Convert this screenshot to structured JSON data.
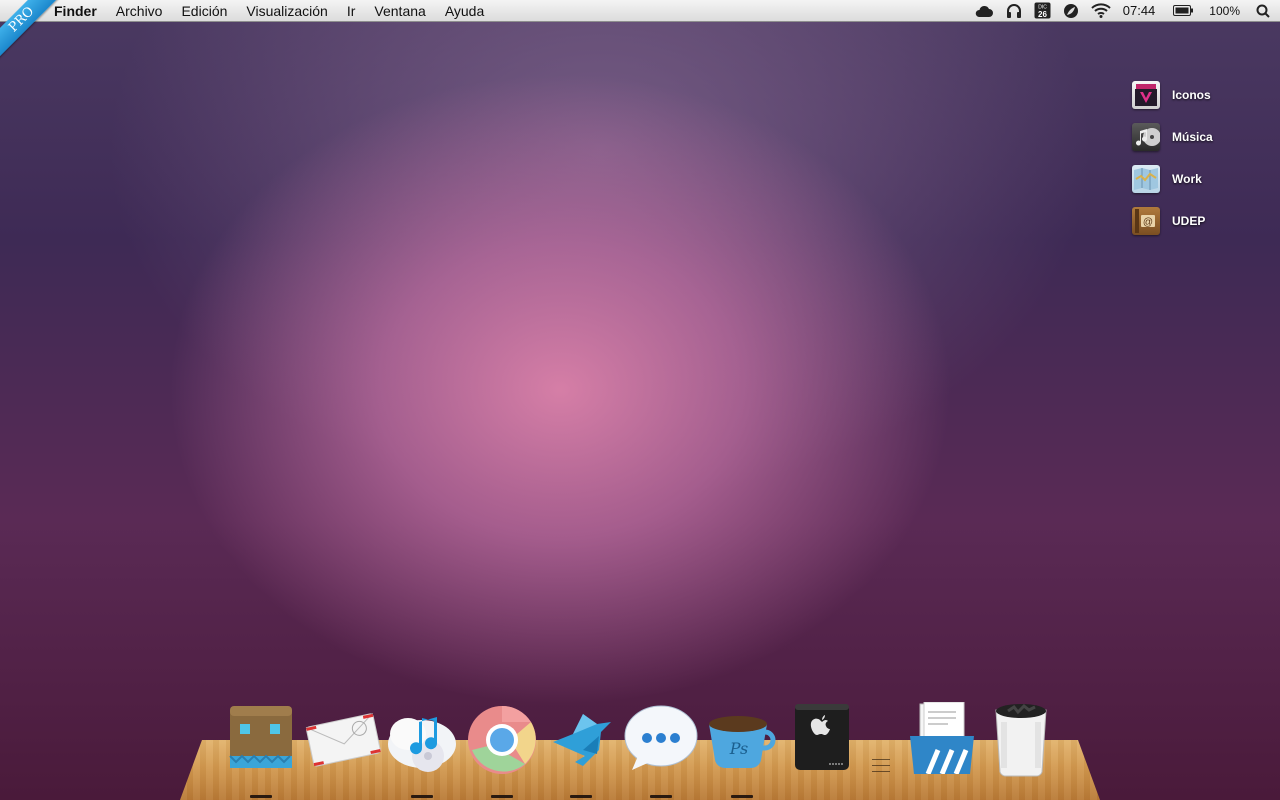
{
  "menubar": {
    "badge": "PRO",
    "apple_menu": "",
    "items": [
      "Finder",
      "Archivo",
      "Edición",
      "Visualización",
      "Ir",
      "Ventana",
      "Ayuda"
    ],
    "status": {
      "calendar_month": "DIC",
      "calendar_day": "26",
      "time": "07:44",
      "battery": "100%"
    }
  },
  "desktop": {
    "items": [
      {
        "label": "Iconos",
        "icon": "iconos-folder-icon"
      },
      {
        "label": "Música",
        "icon": "music-folder-icon"
      },
      {
        "label": "Work",
        "icon": "maps-folder-icon"
      },
      {
        "label": "UDEP",
        "icon": "address-book-icon"
      }
    ]
  },
  "dock": {
    "apps": [
      {
        "name": "finder",
        "icon": "paper-bag-finder-icon",
        "running": true
      },
      {
        "name": "mail",
        "icon": "mail-envelope-icon",
        "running": false
      },
      {
        "name": "itunes",
        "icon": "itunes-icon",
        "running": true
      },
      {
        "name": "chrome",
        "icon": "chrome-icon",
        "running": true
      },
      {
        "name": "twitter",
        "icon": "origami-bird-icon",
        "running": true
      },
      {
        "name": "messages",
        "icon": "chat-bubble-icon",
        "running": true
      },
      {
        "name": "photoshop",
        "icon": "coffee-cup-ps-icon",
        "running": true
      },
      {
        "name": "drive",
        "icon": "apple-hard-drive-icon",
        "running": false
      },
      {
        "name": "documents",
        "icon": "documents-tray-icon",
        "running": false
      },
      {
        "name": "trash",
        "icon": "trash-can-icon",
        "running": false
      }
    ]
  }
}
